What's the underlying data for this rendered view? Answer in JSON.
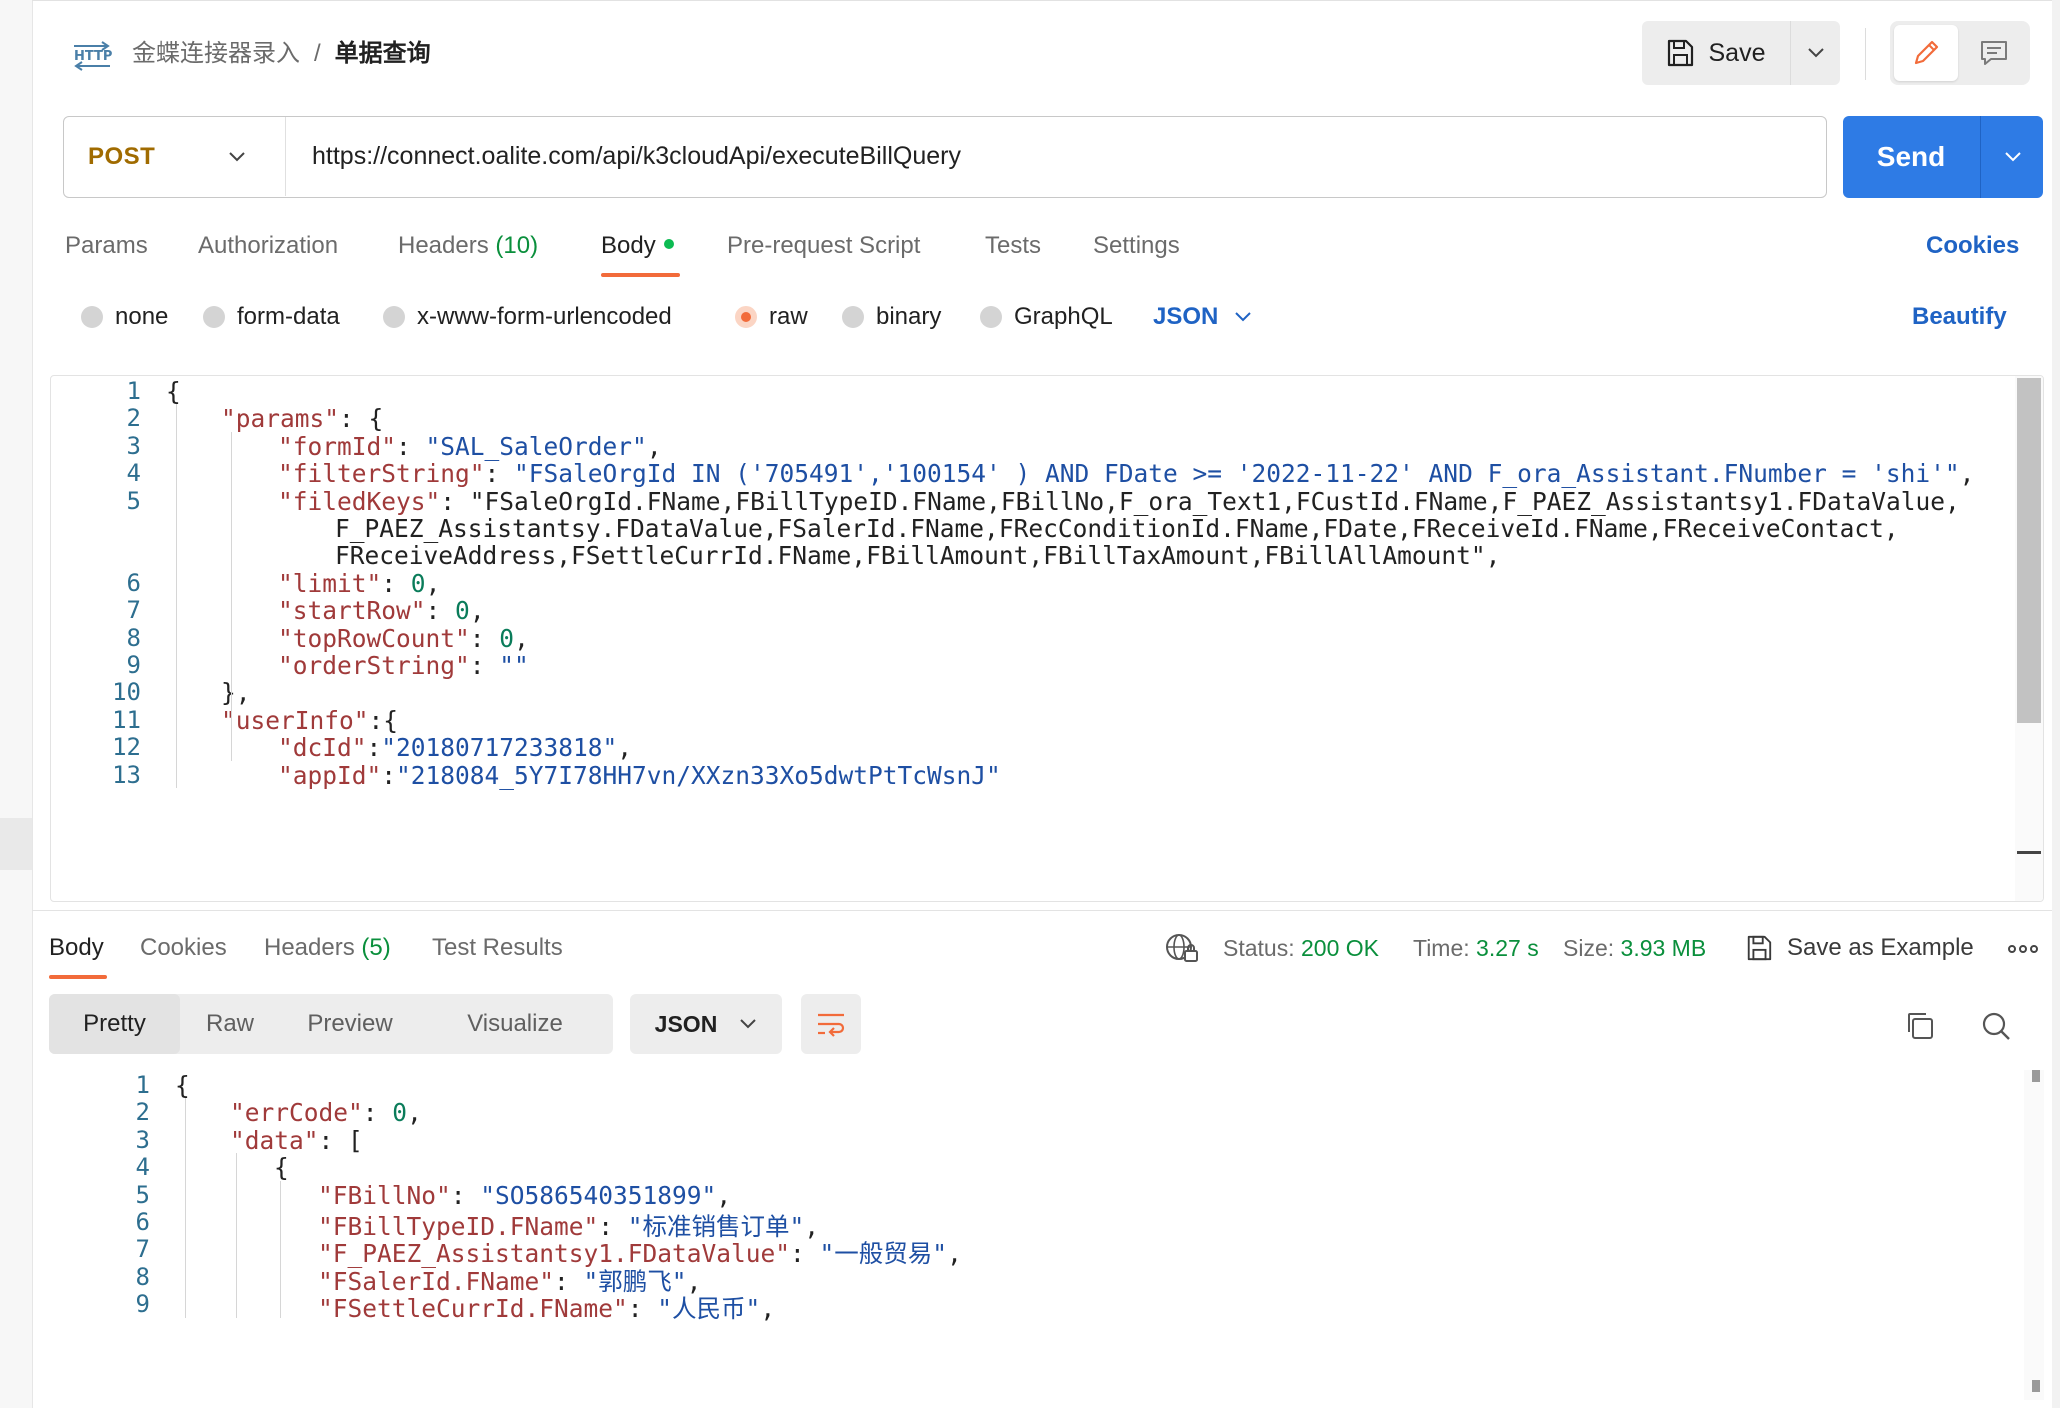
{
  "breadcrumb": {
    "icon_text": "HTTP",
    "parent": "金蝶连接器录入",
    "separator": "/",
    "current": "单据查询"
  },
  "toolbar": {
    "save_label": "Save"
  },
  "request": {
    "method": "POST",
    "url": "https://connect.oalite.com/api/k3cloudApi/executeBillQuery",
    "send_label": "Send"
  },
  "request_tabs": {
    "params": "Params",
    "authorization": "Authorization",
    "headers": "Headers",
    "headers_count": "(10)",
    "body": "Body",
    "prerequest": "Pre-request Script",
    "tests": "Tests",
    "settings": "Settings",
    "cookies": "Cookies"
  },
  "body_types": {
    "none": "none",
    "form_data": "form-data",
    "urlencoded": "x-www-form-urlencoded",
    "raw": "raw",
    "binary": "binary",
    "graphql": "GraphQL",
    "selected": "raw",
    "language": "JSON",
    "beautify": "Beautify"
  },
  "request_body": {
    "line_numbers": [
      "1",
      "2",
      "3",
      "4",
      "5",
      "6",
      "7",
      "8",
      "9",
      "10",
      "11",
      "12",
      "13"
    ],
    "lines": [
      "{",
      "\"params\": {",
      "\"formId\": \"SAL_SaleOrder\",",
      "\"filterString\": \"FSaleOrgId IN ('705491','100154' ) AND FDate >= '2022-11-22' AND F_ora_Assistant.FNumber = 'shi'\",",
      "\"filedKeys\": \"FSaleOrgId.FName,FBillTypeID.FName,FBillNo,F_ora_Text1,FCustId.FName,F_PAEZ_Assistantsy1.FDataValue,",
      "F_PAEZ_Assistantsy.FDataValue,FSalerId.FName,FRecConditionId.FName,FDate,FReceiveId.FName,FReceiveContact,",
      "FReceiveAddress,FSettleCurrId.FName,FBillAmount,FBillTaxAmount,FBillAllAmount\",",
      "\"limit\": 0,",
      "\"startRow\": 0,",
      "\"topRowCount\": 0,",
      "\"orderString\": \"\"",
      "},",
      "\"userInfo\":{",
      "\"dcId\":\"20180717233818\",",
      "\"appId\":\"218084_5Y7I78HH7vn/XXzn33Xo5dwtPtTcWsnJ\""
    ]
  },
  "response_tabs": {
    "body": "Body",
    "cookies": "Cookies",
    "headers": "Headers",
    "headers_count": "(5)",
    "test_results": "Test Results"
  },
  "response_meta": {
    "status_label": "Status:",
    "status_value": "200 OK",
    "time_label": "Time:",
    "time_value": "3.27 s",
    "size_label": "Size:",
    "size_value": "3.93 MB",
    "save_example": "Save as Example"
  },
  "response_view": {
    "pretty": "Pretty",
    "raw": "Raw",
    "preview": "Preview",
    "visualize": "Visualize",
    "language": "JSON"
  },
  "response_body": {
    "line_numbers": [
      "1",
      "2",
      "3",
      "4",
      "5",
      "6",
      "7",
      "8",
      "9"
    ],
    "lines": [
      "{",
      "\"errCode\": 0,",
      "\"data\": [",
      "{",
      "\"FBillNo\": \"SO586540351899\",",
      "\"FBillTypeID.FName\": \"标准销售订单\",",
      "\"F_PAEZ_Assistantsy1.FDataValue\": \"一般贸易\",",
      "\"FSalerId.FName\": \"郭鹏飞\",",
      "\"FSettleCurrId.FName\": \"人民币\","
    ]
  },
  "colors": {
    "accent": "#f26b3a",
    "primary": "#2e7be5",
    "success": "#0a8f3c",
    "method": "#a06b00"
  },
  "icons": [
    "http-icon",
    "save-icon",
    "chevron-down-icon",
    "pencil-icon",
    "comment-icon",
    "globe-lock-icon",
    "more-icon",
    "wrap-lines-icon",
    "copy-icon",
    "search-icon"
  ]
}
